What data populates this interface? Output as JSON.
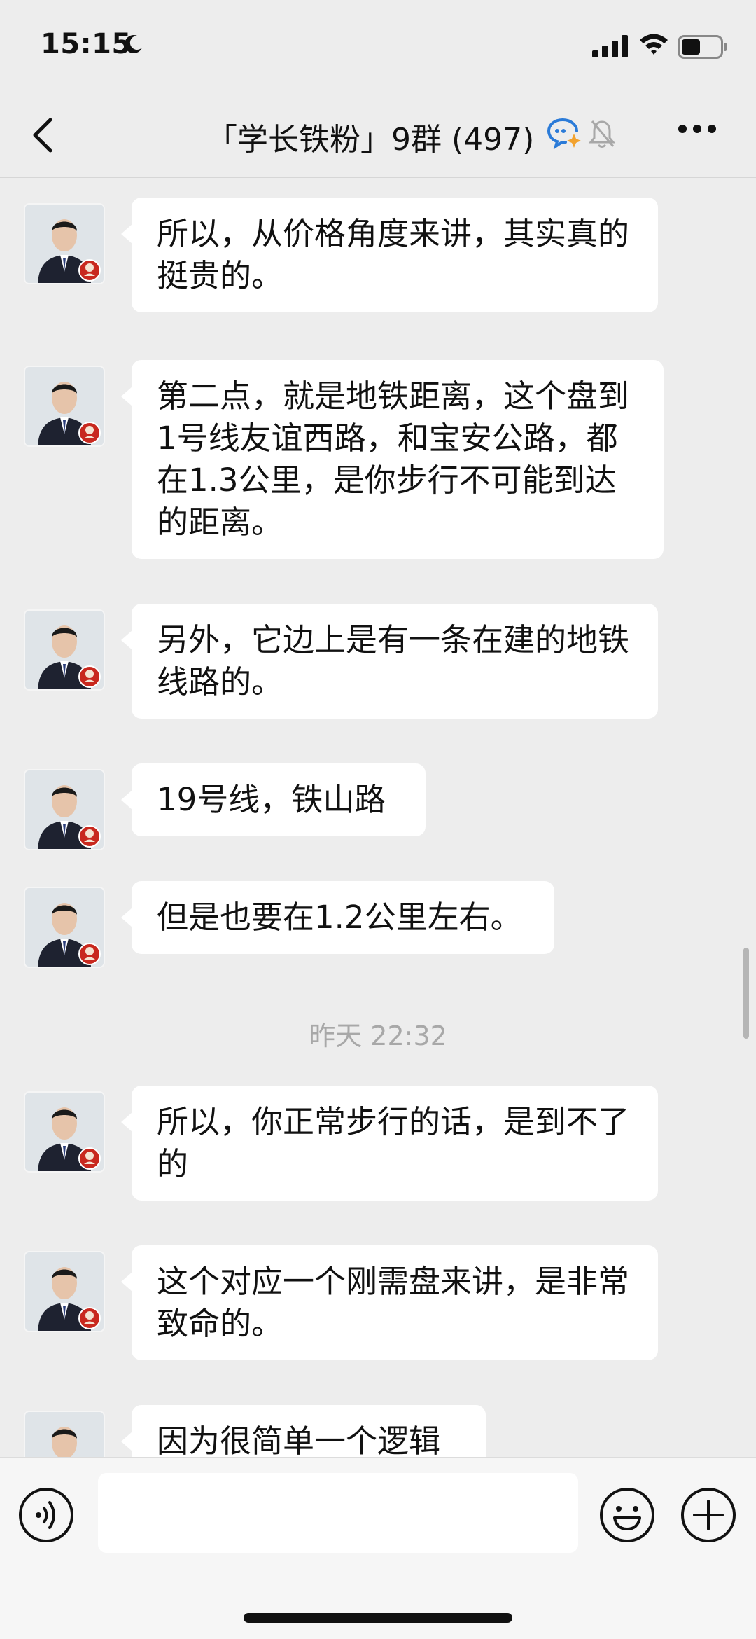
{
  "status_bar": {
    "time": "15:15",
    "icons": [
      "moon-icon",
      "signal-icon",
      "wifi-icon",
      "battery-icon"
    ]
  },
  "nav": {
    "title": "「学长铁粉」9群 (497)",
    "icons": [
      "back-icon",
      "ai-chat-icon",
      "mute-bell-icon",
      "more-icon"
    ]
  },
  "messages": [
    {
      "text": "所以，从价格角度来讲，其实真的挺贵的。"
    },
    {
      "text": "第二点，就是地铁距离，这个盘到1号线友谊西路，和宝安公路，都在1.3公里，是你步行不可能到达的距离。"
    },
    {
      "text": "另外，它边上是有一条在建的地铁线路的。"
    },
    {
      "text": "19号线，铁山路"
    },
    {
      "text": "但是也要在1.2公里左右。"
    },
    {
      "time_divider": "昨天 22:32"
    },
    {
      "text": "所以，你正常步行的话，是到不了的"
    },
    {
      "text": "这个对应一个刚需盘来讲，是非常致命的。"
    },
    {
      "text": "因为很简单一个逻辑"
    }
  ],
  "input": {
    "value": "",
    "icons": [
      "voice-icon",
      "emoji-icon",
      "plus-icon"
    ]
  },
  "colors": {
    "background": "#ededed",
    "bubble": "#ffffff",
    "input_bar": "#f6f6f6"
  }
}
